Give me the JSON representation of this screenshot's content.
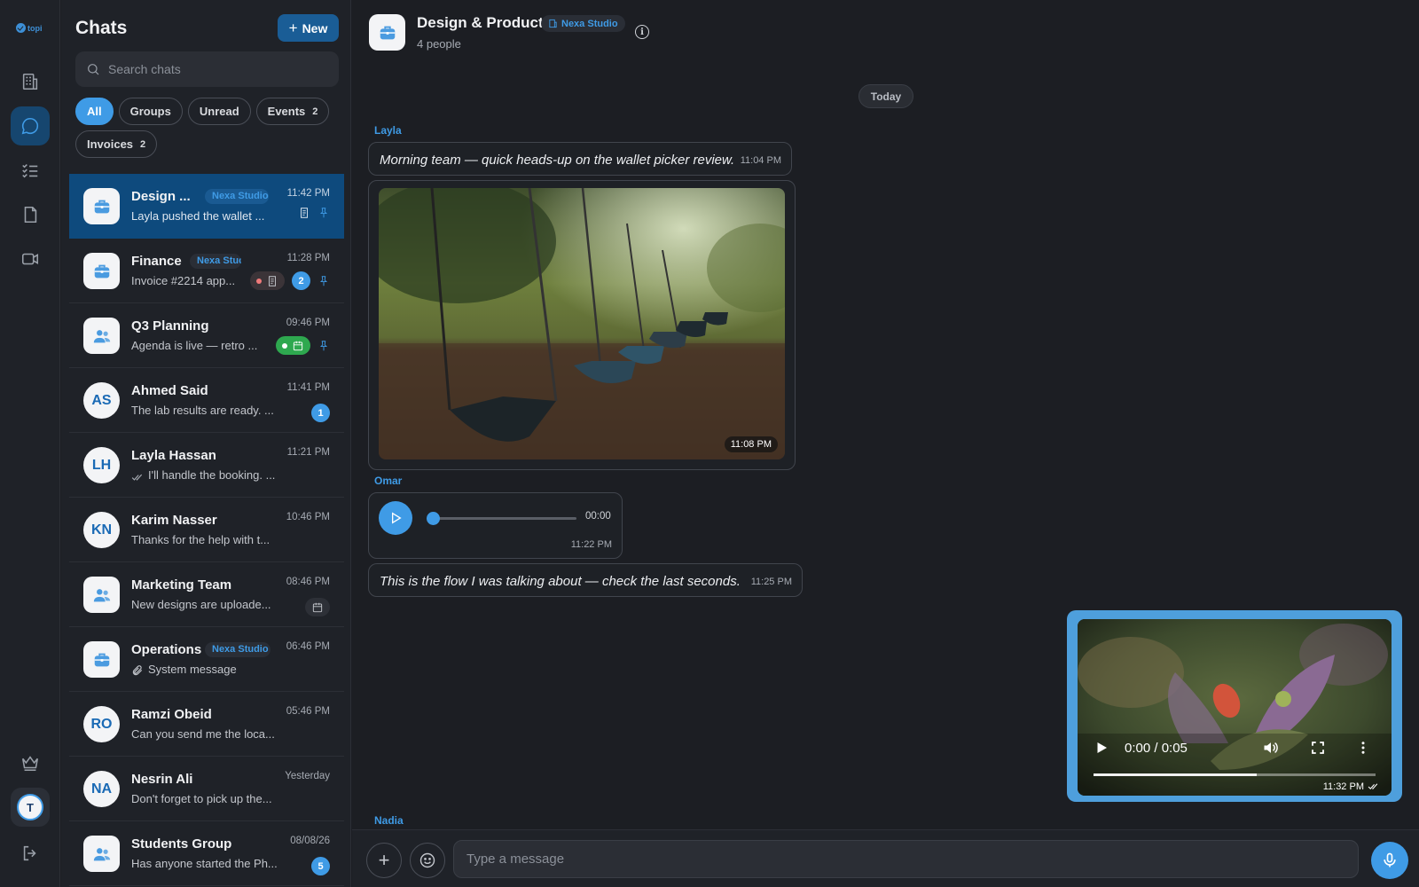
{
  "rail": {
    "logo": "topi",
    "user_initial": "T"
  },
  "list": {
    "title": "Chats",
    "new_label": "New",
    "search_placeholder": "Search chats",
    "filters": [
      {
        "label": "All",
        "count": ""
      },
      {
        "label": "Groups",
        "count": ""
      },
      {
        "label": "Unread",
        "count": ""
      },
      {
        "label": "Events",
        "count": "2"
      },
      {
        "label": "Invoices",
        "count": "2"
      }
    ],
    "chats": [
      {
        "name": "Design ...",
        "org": "Nexa Studio",
        "time": "11:42 PM",
        "preview": "Layla pushed the wallet ...",
        "initials": ""
      },
      {
        "name": "Finance",
        "org": "Nexa Studio",
        "time": "11:28 PM",
        "preview": "Invoice #2214 app...",
        "badge": "2",
        "initials": ""
      },
      {
        "name": "Q3 Planning",
        "org": "",
        "time": "09:46 PM",
        "preview": "Agenda is live — retro ...",
        "initials": ""
      },
      {
        "name": "Ahmed Said",
        "org": "",
        "time": "11:41 PM",
        "preview": "The lab results are ready. ...",
        "badge": "1",
        "initials": "AS"
      },
      {
        "name": "Layla Hassan",
        "org": "",
        "time": "11:21 PM",
        "preview": "I'll handle the booking. ...",
        "initials": "LH"
      },
      {
        "name": "Karim Nasser",
        "org": "",
        "time": "10:46 PM",
        "preview": "Thanks for the help with t...",
        "initials": "KN"
      },
      {
        "name": "Marketing Team",
        "org": "",
        "time": "08:46 PM",
        "preview": "New designs are uploade...",
        "initials": ""
      },
      {
        "name": "Operations",
        "org": "Nexa Studio",
        "time": "06:46 PM",
        "preview": "System message",
        "initials": ""
      },
      {
        "name": "Ramzi Obeid",
        "org": "",
        "time": "05:46 PM",
        "preview": "Can you send me the loca...",
        "initials": "RO"
      },
      {
        "name": "Nesrin Ali",
        "org": "",
        "time": "Yesterday",
        "preview": "Don't forget to pick up the...",
        "initials": "NA"
      },
      {
        "name": "Students Group",
        "org": "",
        "time": "08/08/26",
        "preview": "Has anyone started the Ph...",
        "badge": "5",
        "initials": ""
      }
    ]
  },
  "header": {
    "title": "Design & Product",
    "org": "Nexa Studio",
    "subtitle": "4 people"
  },
  "conversation": {
    "day_label": "Today",
    "messages": [
      {
        "sender": "Layla",
        "text": "Morning team — quick heads-up on the wallet picker review.",
        "time": "11:04 PM"
      },
      {
        "sender": "",
        "image": "swings-photo",
        "time": "11:08 PM"
      },
      {
        "sender": "Omar",
        "voice_duration": "00:00",
        "time": "11:22 PM"
      },
      {
        "sender": "",
        "text": "This is the flow I was talking about — check the last seconds.",
        "time": "11:25 PM"
      },
      {
        "sender": "",
        "video_time": "0:00 / 0:05",
        "time": "11:32 PM",
        "progress": 0.58
      }
    ],
    "next_sender": "Nadia"
  },
  "composer": {
    "placeholder": "Type a message"
  },
  "colors": {
    "accent": "#3f9be6",
    "selected_row": "#0e4a7d",
    "background": "#1c1e23"
  }
}
